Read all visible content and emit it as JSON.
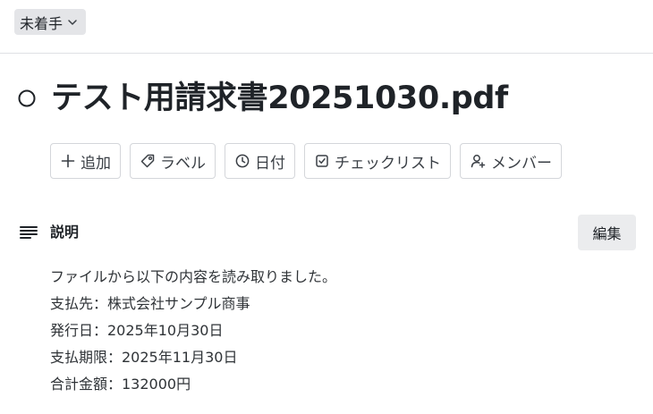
{
  "status": {
    "label": "未着手"
  },
  "card": {
    "title": "テスト用請求書20251030.pdf"
  },
  "actions": [
    {
      "label": "追加",
      "icon": "plus-icon"
    },
    {
      "label": "ラベル",
      "icon": "tag-icon"
    },
    {
      "label": "日付",
      "icon": "clock-icon"
    },
    {
      "label": "チェックリスト",
      "icon": "checkbox-icon"
    },
    {
      "label": "メンバー",
      "icon": "add-member-icon"
    }
  ],
  "description": {
    "heading": "説明",
    "edit_label": "編集",
    "lines": [
      "ファイルから以下の内容を読み取りました。",
      "支払先：株式会社サンプル商事",
      "発行日：2025年10月30日",
      "支払期限：2025年11月30日",
      "合計金額：132000円"
    ]
  },
  "colors": {
    "text": "#1f2328",
    "status_bg": "#e4e5e8",
    "button_border": "#d4d6da",
    "edit_bg": "#ebecee"
  }
}
